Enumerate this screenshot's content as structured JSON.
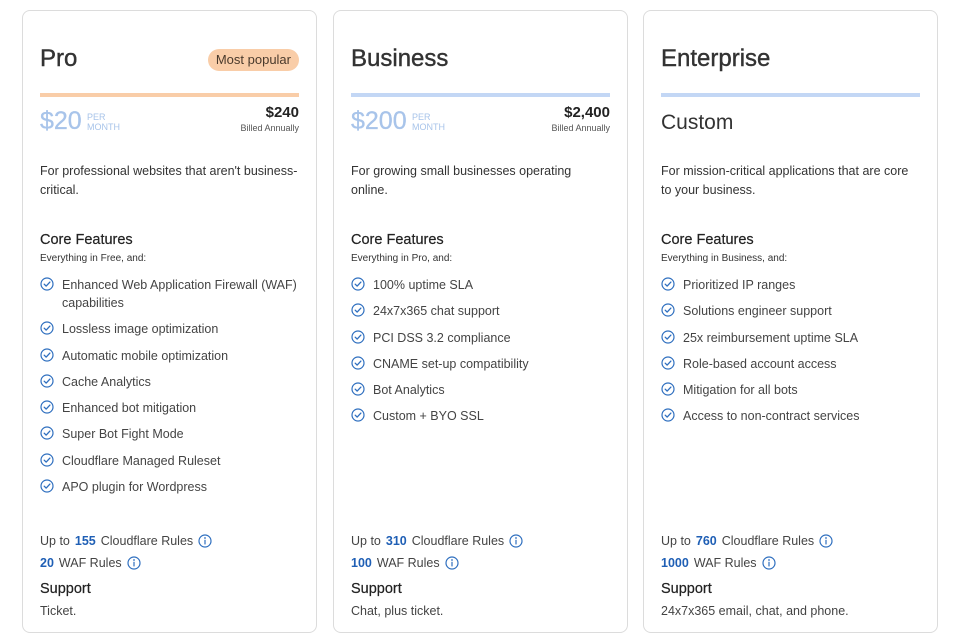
{
  "colors": {
    "pro_accent": "#f9cda8",
    "business_accent": "#c3d7f5",
    "enterprise_accent": "#c3d7f5",
    "price_color": "#a8c4ea",
    "check_color": "#2f6fbf",
    "rules_number_color": "#1f5fb5"
  },
  "plans": [
    {
      "name": "Pro",
      "badge": "Most popular",
      "price": "$20",
      "per_line1": "PER",
      "per_line2": "MONTH",
      "annual_price": "$240",
      "annual_label": "Billed Annually",
      "description": "For professional websites that aren't business-critical.",
      "core_title": "Core Features",
      "core_subtitle": "Everything in Free, and:",
      "features": [
        "Enhanced Web Application Firewall (WAF) capabilities",
        "Lossless image optimization",
        "Automatic mobile optimization",
        "Cache Analytics",
        "Enhanced bot mitigation",
        "Super Bot Fight Mode",
        "Cloudflare Managed Ruleset",
        "APO plugin for Wordpress"
      ],
      "rules_prefix": "Up to",
      "cloudflare_rules": "155",
      "cloudflare_rules_label": "Cloudflare Rules",
      "waf_rules": "20",
      "waf_rules_label": "WAF Rules",
      "support_title": "Support",
      "support_text": "Ticket."
    },
    {
      "name": "Business",
      "price": "$200",
      "per_line1": "PER",
      "per_line2": "MONTH",
      "annual_price": "$2,400",
      "annual_label": "Billed Annually",
      "description": "For growing small businesses operating online.",
      "core_title": "Core Features",
      "core_subtitle": "Everything in Pro, and:",
      "features": [
        "100% uptime SLA",
        "24x7x365 chat support",
        "PCI DSS 3.2 compliance",
        "CNAME set-up compatibility",
        "Bot Analytics",
        "Custom + BYO SSL"
      ],
      "rules_prefix": "Up to",
      "cloudflare_rules": "310",
      "cloudflare_rules_label": "Cloudflare Rules",
      "waf_rules": "100",
      "waf_rules_label": "WAF Rules",
      "support_title": "Support",
      "support_text": "Chat, plus ticket."
    },
    {
      "name": "Enterprise",
      "price_custom": "Custom",
      "description": "For mission-critical applications that are core to your business.",
      "core_title": "Core Features",
      "core_subtitle": "Everything in Business, and:",
      "features": [
        "Prioritized IP ranges",
        "Solutions engineer support",
        "25x reimbursement uptime SLA",
        "Role-based account access",
        "Mitigation for all bots",
        "Access to non-contract services"
      ],
      "rules_prefix": "Up to",
      "cloudflare_rules": "760",
      "cloudflare_rules_label": "Cloudflare Rules",
      "waf_rules": "1000",
      "waf_rules_label": "WAF Rules",
      "support_title": "Support",
      "support_text": "24x7x365 email, chat, and phone."
    }
  ]
}
